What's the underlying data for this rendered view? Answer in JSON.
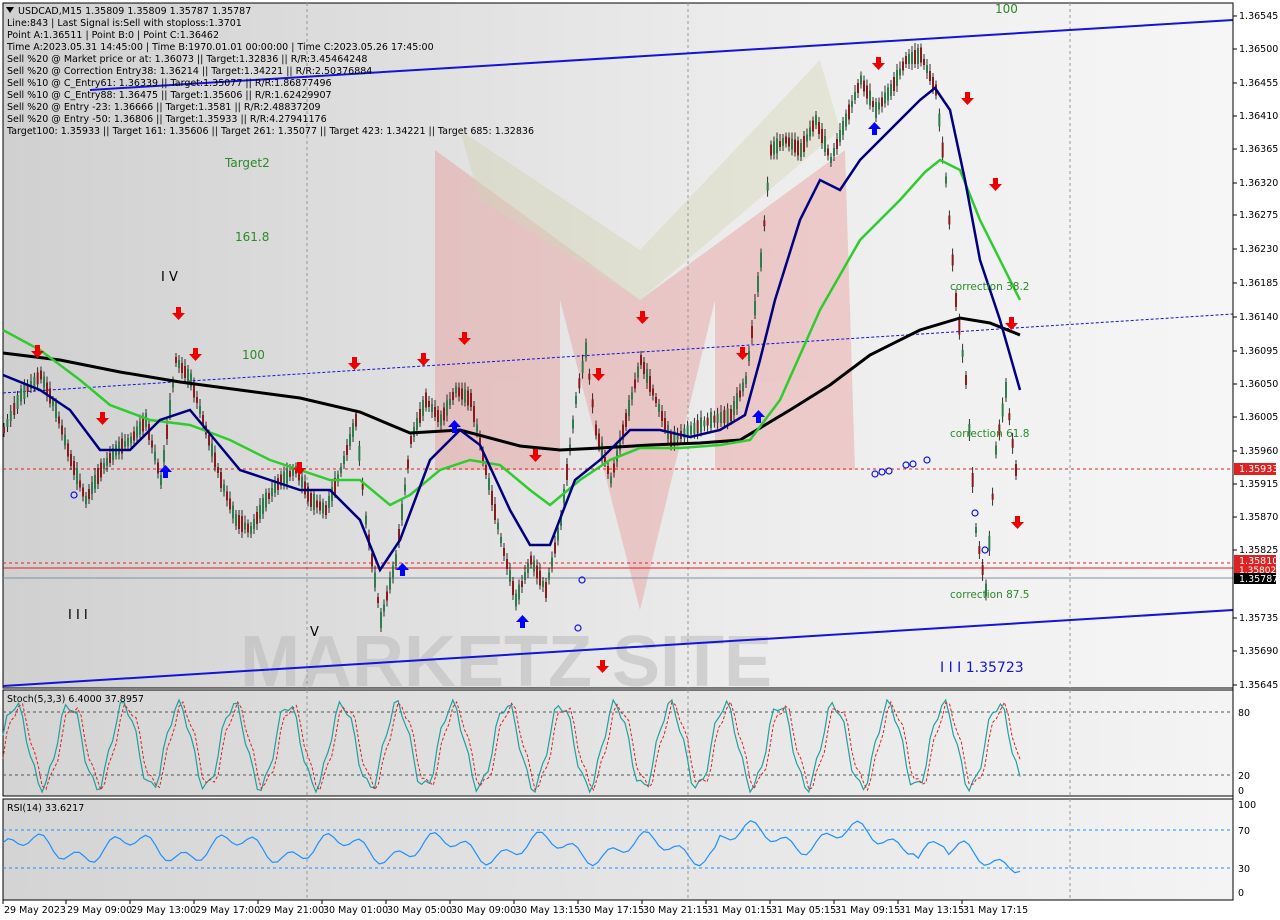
{
  "header": {
    "lines": [
      "USDCAD,M15  1.35809 1.35809 1.35787 1.35787",
      "Line:843 | Last Signal is:Sell with stoploss:1.3701",
      "Point A:1.36511 | Point B:0 | Point C:1.36462",
      "Time A:2023.05.31 14:45:00 | Time B:1970.01.01 00:00:00 | Time C:2023.05.26 17:45:00",
      "Sell %20 @ Market price or at: 1.36073 || Target:1.32836 || R/R:3.45464248",
      "Sell %20 @ Correction Entry38: 1.36214 || Target:1.34221 || R/R:2.50376884",
      "Sell %10 @ C_Entry61: 1.36339 || Target:1.35077 || R/R:1.86877496",
      "Sell %10 @ C_Entry88: 1.36475 || Target:1.35606 || R/R:1.62429907",
      "Sell %20 @ Entry -23: 1.36666 || Target:1.3581 || R/R:2.48837209",
      "Sell %20 @ Entry -50: 1.36806 || Target:1.35933 || R/R:4.27941176",
      "Target100: 1.35933 || Target 161: 1.35606 || Target 261: 1.35077 || Target 423: 1.34221 || Target 685: 1.32836"
    ]
  },
  "annotations": {
    "target2": "Target2",
    "fib_1618": "161.8",
    "fib_100_left": "100",
    "fib_100_top": "100",
    "wave_iv": "I V",
    "wave_iii": "I I I",
    "wave_v": "V",
    "wave_iii_price": "I I I 1.35723",
    "correction_382": "correction 38.2",
    "correction_618": "correction 61.8",
    "correction_875": "correction 87.5"
  },
  "price_axis": {
    "ticks": [
      "1.36545",
      "1.36500",
      "1.36455",
      "1.36410",
      "1.36365",
      "1.36320",
      "1.36275",
      "1.36230",
      "1.36185",
      "1.36140",
      "1.36095",
      "1.36050",
      "1.36005",
      "1.35960",
      "1.35915",
      "1.35870",
      "1.35825",
      "1.35735",
      "1.35690",
      "1.35645"
    ],
    "badges": {
      "red_level": "1.35933",
      "red_level_2": "1.35810",
      "red_level_3": "1.35802",
      "current": "1.35787"
    }
  },
  "stoch": {
    "label": "Stoch(5,3,3) 6.4000 37.8957",
    "levels": [
      "80",
      "20",
      "0"
    ]
  },
  "rsi": {
    "label": "RSI(14) 33.6217",
    "levels": [
      "100",
      "70",
      "30",
      "0"
    ]
  },
  "time_axis": {
    "labels": [
      "29 May 2023",
      "29 May 09:00",
      "29 May 13:00",
      "29 May 17:00",
      "29 May 21:00",
      "30 May 01:00",
      "30 May 05:00",
      "30 May 09:00",
      "30 May 13:15",
      "30 May 17:15",
      "30 May 21:15",
      "31 May 01:15",
      "31 May 05:15",
      "31 May 09:15",
      "31 May 13:15",
      "31 May 17:15"
    ]
  },
  "watermark": "MARKETZ SITE",
  "colors": {
    "channel": "#1414d8",
    "ma_fast": "#000080",
    "ma_mid": "#2ecc2e",
    "ma_slow": "#000000",
    "level_red": "#dd2222",
    "bull": "#26a69a",
    "signal_down": "#ee0000",
    "signal_up": "#0000ff"
  }
}
